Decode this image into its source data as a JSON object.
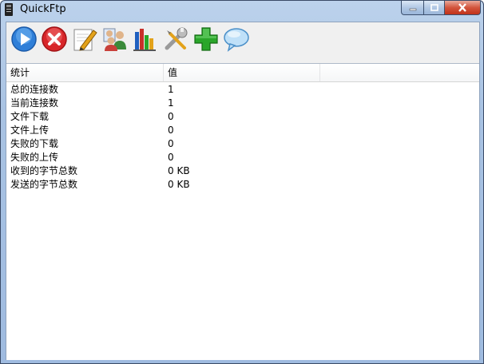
{
  "window": {
    "title": "QuickFtp"
  },
  "controls": {
    "minimize": "—",
    "maximize": "□",
    "close": "✕"
  },
  "toolbar": {
    "buttons": [
      {
        "icon": "play-icon",
        "color": "#2f7fd8"
      },
      {
        "icon": "stop-icon",
        "color": "#d8262a"
      },
      {
        "icon": "edit-icon",
        "color": "#e3a21a"
      },
      {
        "icon": "users-icon",
        "color": "#3a8a3a"
      },
      {
        "icon": "statistics-icon",
        "color": "#1f5fbf"
      },
      {
        "icon": "settings-icon",
        "color": "#8a8a8a"
      },
      {
        "icon": "add-icon",
        "color": "#2aa62a"
      },
      {
        "icon": "message-icon",
        "color": "#6fb3e8"
      }
    ]
  },
  "list": {
    "columns": [
      "统计",
      "值"
    ],
    "rows": [
      {
        "name": "总的连接数",
        "value": "1"
      },
      {
        "name": "当前连接数",
        "value": "1"
      },
      {
        "name": "文件下载",
        "value": "0"
      },
      {
        "name": "文件上传",
        "value": "0"
      },
      {
        "name": "失败的下载",
        "value": "0"
      },
      {
        "name": "失败的上传",
        "value": "0"
      },
      {
        "name": "收到的字节总数",
        "value": "0 KB"
      },
      {
        "name": "发送的字节总数",
        "value": "0 KB"
      }
    ]
  }
}
